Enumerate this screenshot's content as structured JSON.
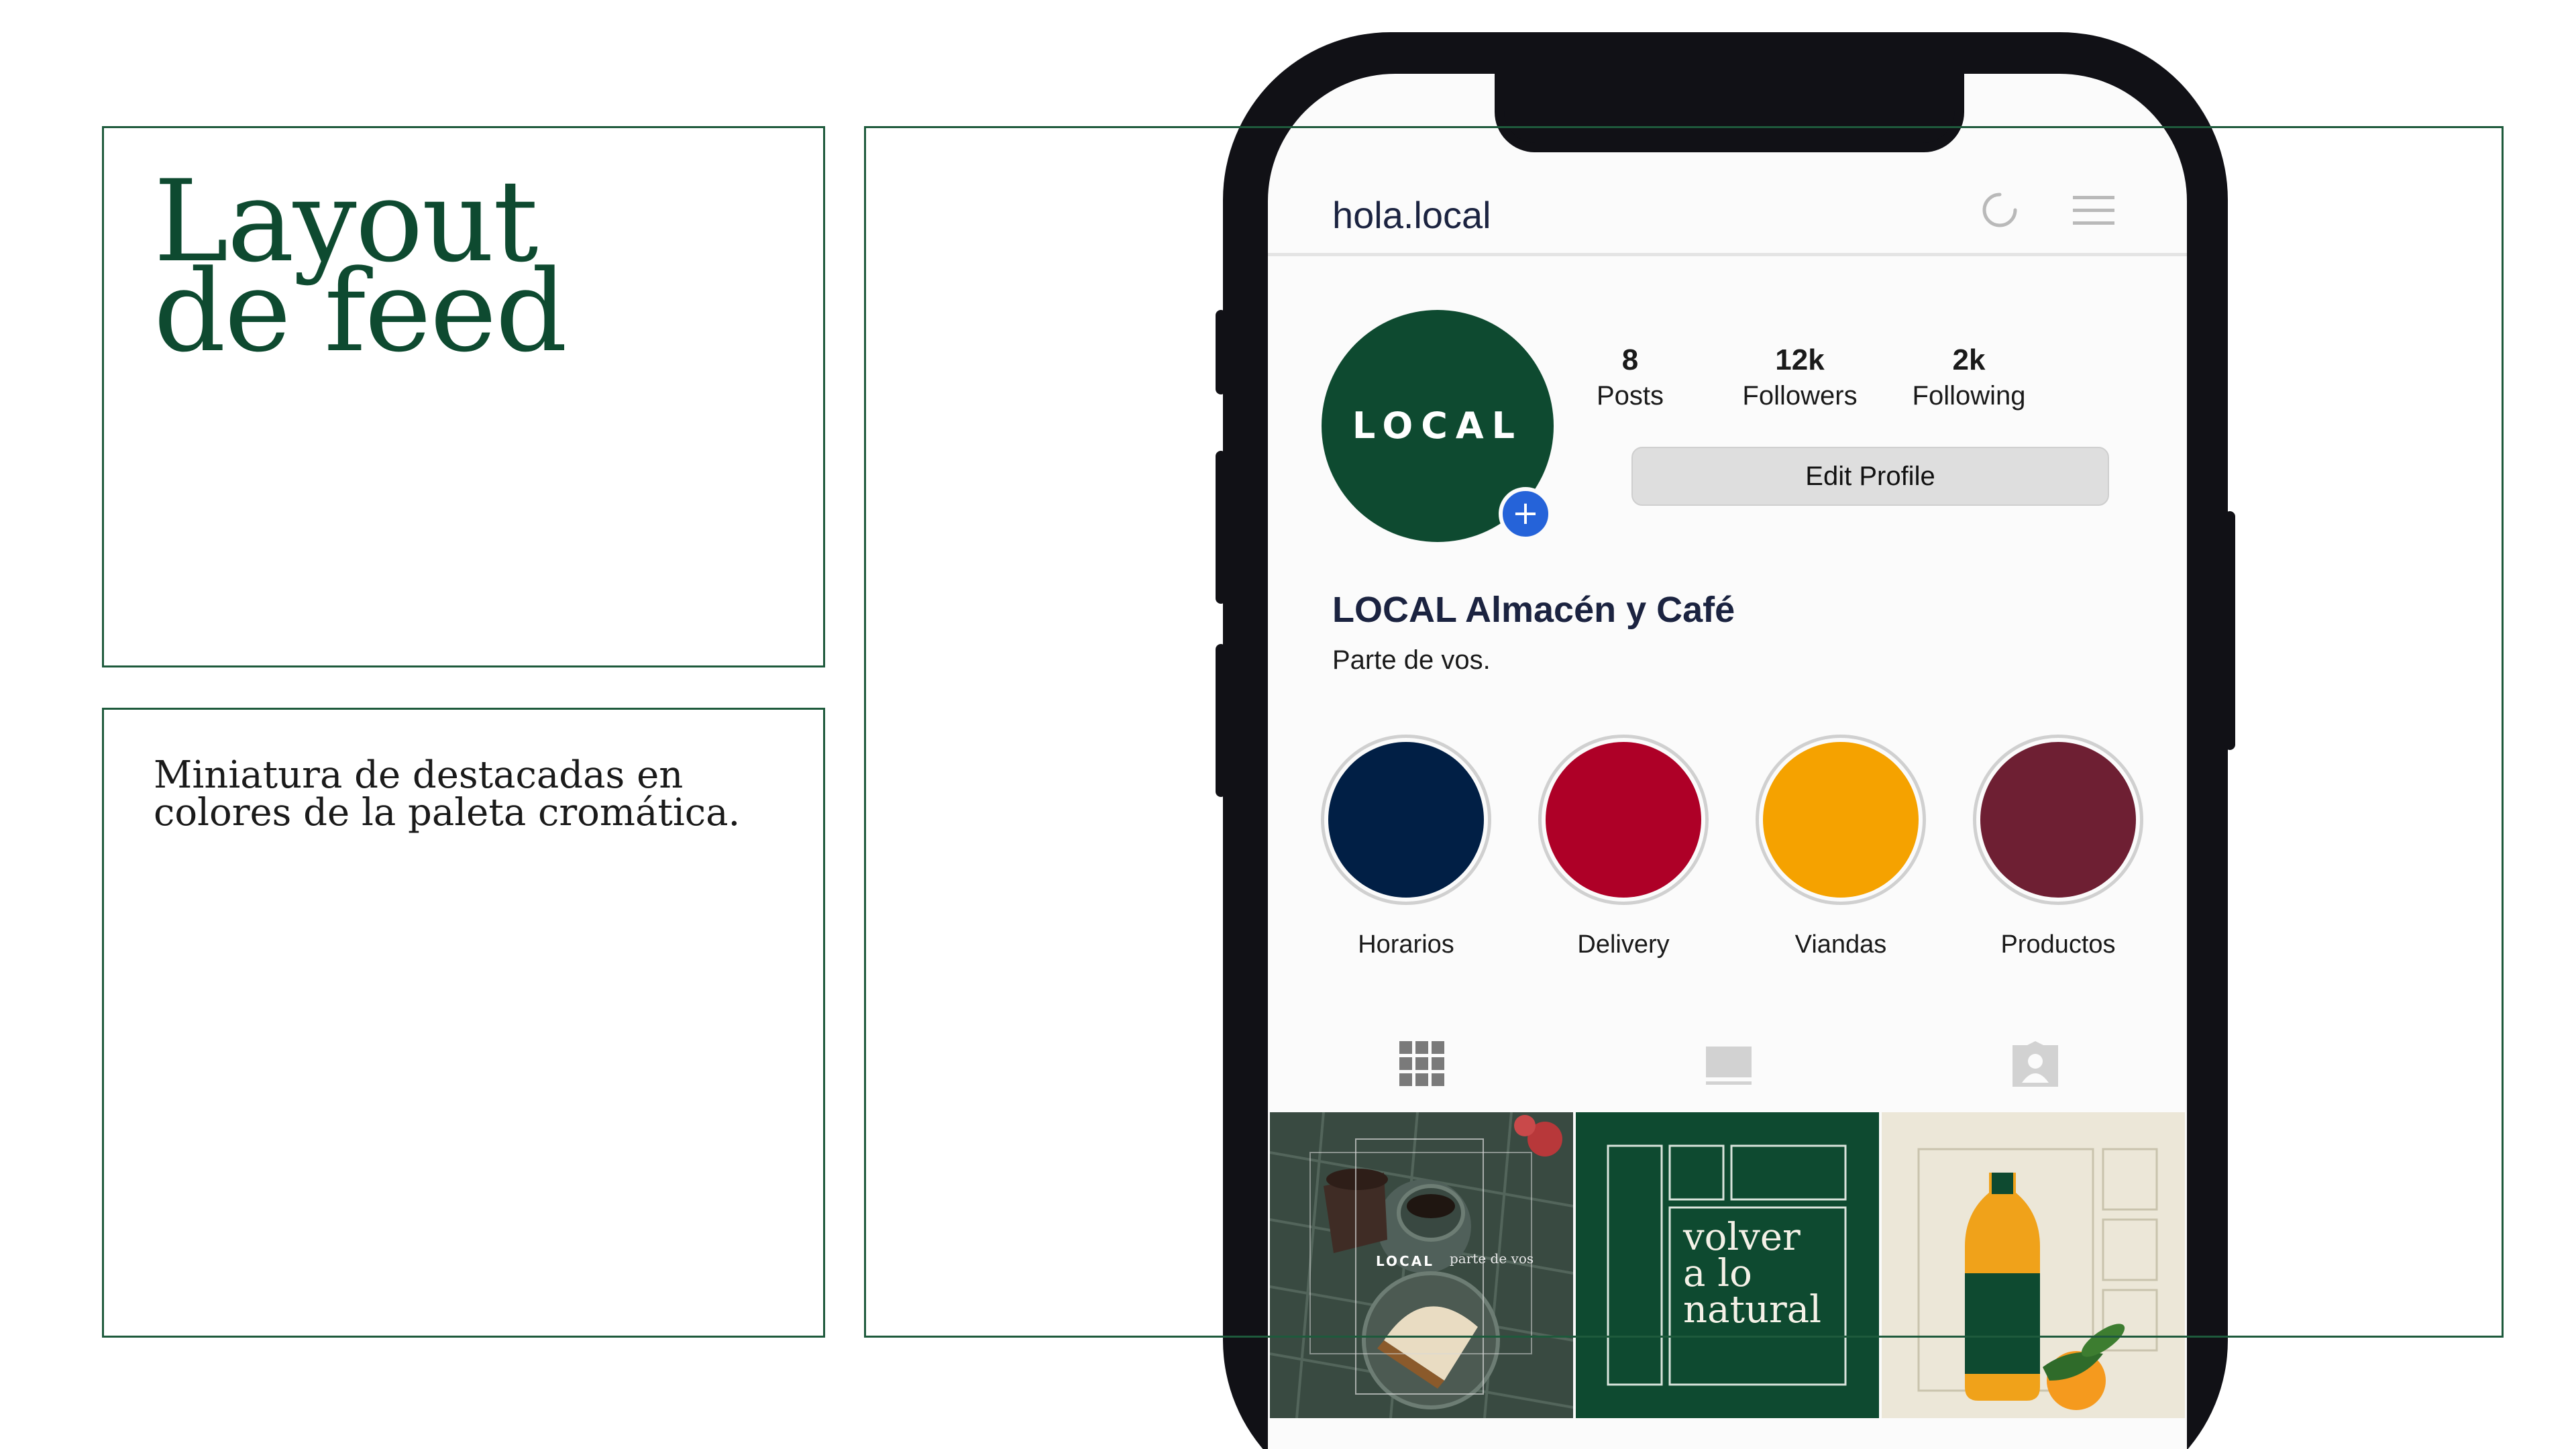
{
  "slide": {
    "title_line1": "Layout",
    "title_line2": "de feed",
    "description": "Miniatura de destacadas en colores de la paleta cromática."
  },
  "profile": {
    "username": "hola.local",
    "avatar_text": "LOCAL",
    "add_symbol": "+",
    "stats": [
      {
        "value": "8",
        "label": "Posts"
      },
      {
        "value": "12k",
        "label": "Followers"
      },
      {
        "value": "2k",
        "label": "Following"
      }
    ],
    "edit_button": "Edit Profile",
    "name": "LOCAL Almacén y Café",
    "bio": "Parte de vos."
  },
  "highlights": [
    {
      "label": "Horarios",
      "color": "#011f45"
    },
    {
      "label": "Delivery",
      "color": "#ae0027"
    },
    {
      "label": "Viandas",
      "color": "#f5a200"
    },
    {
      "label": "Productos",
      "color": "#6e1f33"
    }
  ],
  "tabs": [
    {
      "name": "grid-icon"
    },
    {
      "name": "feed-icon"
    },
    {
      "name": "tagged-icon"
    }
  ],
  "posts": [
    {
      "brand": "LOCAL",
      "tagline": "parte de vos"
    },
    {
      "text_line1": "volver",
      "text_line2": "a lo",
      "text_line3": "natural"
    },
    {
      "label": "juice-bottle"
    }
  ],
  "colors": {
    "brand_green": "#0e4a30",
    "frame_border": "#1e5a3c",
    "badge_blue": "#2563d9"
  }
}
